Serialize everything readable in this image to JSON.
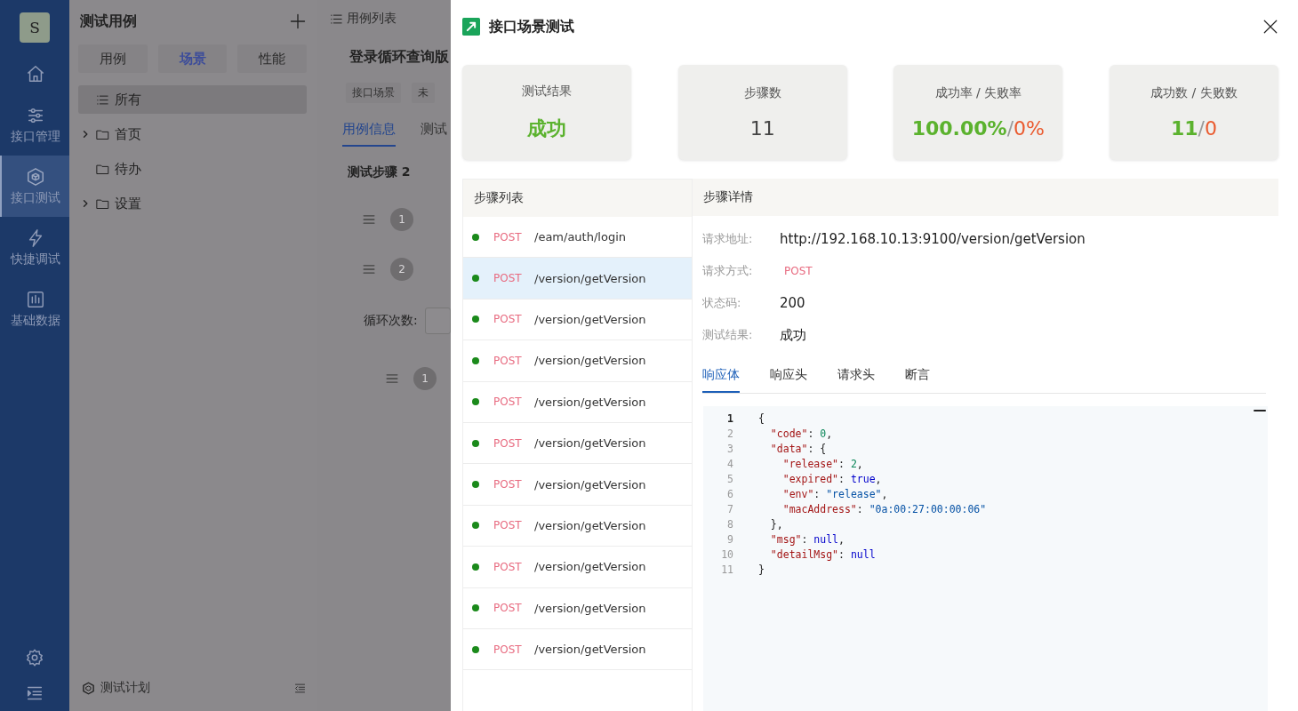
{
  "nav": {
    "avatar": "S",
    "items": [
      {
        "selected": false
      },
      {
        "label": "接口管理",
        "selected": false
      },
      {
        "label": "接口测试",
        "selected": true
      },
      {
        "label": "快捷调试",
        "selected": false
      },
      {
        "label": "基础数据",
        "selected": false
      }
    ]
  },
  "case_panel": {
    "title": "测试用例",
    "segments": [
      {
        "label": "用例",
        "selected": false
      },
      {
        "label": "场景",
        "selected": true
      },
      {
        "label": "性能",
        "selected": false
      }
    ],
    "tree": [
      {
        "label": "所有",
        "kind": "all",
        "expandable": false,
        "selected": true
      },
      {
        "label": "首页",
        "kind": "folder",
        "expandable": true,
        "expanded": false,
        "selected": false
      },
      {
        "label": "待办",
        "kind": "folder",
        "expandable": false,
        "selected": false
      },
      {
        "label": "设置",
        "kind": "folder",
        "expandable": true,
        "expanded": false,
        "selected": false
      }
    ],
    "footer": "测试计划"
  },
  "case_detail": {
    "breadcrumb": "用例列表",
    "title": "登录循环查询版",
    "tags": [
      "接口场景",
      "未"
    ],
    "tabs": [
      {
        "label": "用例信息",
        "selected": true
      },
      {
        "label": "测试",
        "selected": false
      }
    ],
    "section": "测试步骤 2",
    "steps": [
      {
        "kind": "step",
        "number": "1"
      },
      {
        "kind": "step",
        "number": "2"
      },
      {
        "kind": "loop",
        "label": "循环次数:"
      },
      {
        "kind": "nested",
        "number": "1"
      }
    ]
  },
  "drawer": {
    "title": "接口场景测试",
    "stats": [
      {
        "label": "测试结果",
        "parts": [
          {
            "text": "成功",
            "kind": "success"
          }
        ]
      },
      {
        "label": "步骤数",
        "parts": [
          {
            "text": "11",
            "kind": "plain"
          }
        ]
      },
      {
        "label": "成功率 / 失败率",
        "parts": [
          {
            "text": "100.00%",
            "kind": "success"
          },
          {
            "text": "/",
            "kind": "sep"
          },
          {
            "text": "0%",
            "kind": "fail"
          }
        ]
      },
      {
        "label": "成功数 / 失败数",
        "parts": [
          {
            "text": "11",
            "kind": "success"
          },
          {
            "text": "/",
            "kind": "sep"
          },
          {
            "text": "0",
            "kind": "fail"
          }
        ]
      }
    ],
    "step_list": {
      "title": "步骤列表",
      "items": [
        {
          "method": "POST",
          "path": "/eam/auth/login",
          "passed": true,
          "selected": false
        },
        {
          "method": "POST",
          "path": "/version/getVersion",
          "passed": true,
          "selected": true
        },
        {
          "method": "POST",
          "path": "/version/getVersion",
          "passed": true,
          "selected": false
        },
        {
          "method": "POST",
          "path": "/version/getVersion",
          "passed": true,
          "selected": false
        },
        {
          "method": "POST",
          "path": "/version/getVersion",
          "passed": true,
          "selected": false
        },
        {
          "method": "POST",
          "path": "/version/getVersion",
          "passed": true,
          "selected": false
        },
        {
          "method": "POST",
          "path": "/version/getVersion",
          "passed": true,
          "selected": false
        },
        {
          "method": "POST",
          "path": "/version/getVersion",
          "passed": true,
          "selected": false
        },
        {
          "method": "POST",
          "path": "/version/getVersion",
          "passed": true,
          "selected": false
        },
        {
          "method": "POST",
          "path": "/version/getVersion",
          "passed": true,
          "selected": false
        },
        {
          "method": "POST",
          "path": "/version/getVersion",
          "passed": true,
          "selected": false
        }
      ]
    },
    "step_detail": {
      "title": "步骤详情",
      "fields": [
        {
          "label": "请求地址:",
          "value": "http://192.168.10.13:9100/version/getVersion",
          "kind": "plain"
        },
        {
          "label": "请求方式:",
          "value": "POST",
          "kind": "method"
        },
        {
          "label": "状态码:",
          "value": "200",
          "kind": "plain"
        },
        {
          "label": "测试结果:",
          "value": "成功",
          "kind": "plain"
        }
      ],
      "tabs": [
        {
          "label": "响应体",
          "selected": true
        },
        {
          "label": "响应头",
          "selected": false
        },
        {
          "label": "请求头",
          "selected": false
        },
        {
          "label": "断言",
          "selected": false
        }
      ],
      "code": [
        {
          "number": "1",
          "text": "{",
          "active": true
        },
        {
          "number": "2",
          "text": "  \"code\": 0,",
          "active": false
        },
        {
          "number": "3",
          "text": "  \"data\": {",
          "active": false
        },
        {
          "number": "4",
          "text": "    \"release\": 2,",
          "active": false
        },
        {
          "number": "5",
          "text": "    \"expired\": true,",
          "active": false
        },
        {
          "number": "6",
          "text": "    \"env\": \"release\",",
          "active": false
        },
        {
          "number": "7",
          "text": "    \"macAddress\": \"0a:00:27:00:00:06\"",
          "active": false
        },
        {
          "number": "8",
          "text": "  },",
          "active": false
        },
        {
          "number": "9",
          "text": "  \"msg\": null,",
          "active": false
        },
        {
          "number": "10",
          "text": "  \"detailMsg\": null",
          "active": false
        },
        {
          "number": "11",
          "text": "}",
          "active": false
        }
      ]
    }
  }
}
